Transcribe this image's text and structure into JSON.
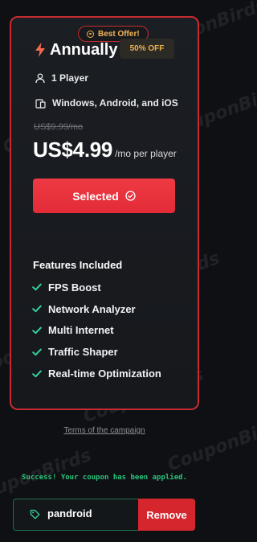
{
  "offer": {
    "badge_text": "Best Offer!",
    "plan_name": "Annually",
    "discount_label": "50% OFF",
    "players_text": "1 Player",
    "platforms_text": "Windows, Android, and iOS",
    "old_price": "US$9.99/mo",
    "price": "US$4.99",
    "price_unit": "/mo per player",
    "selected_label": "Selected"
  },
  "features": {
    "title": "Features Included",
    "items": [
      "FPS Boost",
      "Network Analyzer",
      "Multi Internet",
      "Traffic Shaper",
      "Real-time Optimization"
    ]
  },
  "footer": {
    "terms_link": "Terms of the campaign",
    "success_message": "Success! Your coupon has been applied.",
    "coupon_code": "pandroid",
    "remove_label": "Remove"
  },
  "watermark": "CouponBirds",
  "colors": {
    "accent_red": "#e22b36",
    "badge_gold": "#f0b24b",
    "check_green": "#34d399",
    "success_green": "#29c37a"
  },
  "icons": {
    "badge": "star-circle-icon",
    "plan": "lightning-bolt-icon",
    "players": "user-icon",
    "platforms": "devices-icon",
    "selected": "check-circle-icon",
    "feature": "check-icon",
    "coupon": "tag-icon"
  }
}
